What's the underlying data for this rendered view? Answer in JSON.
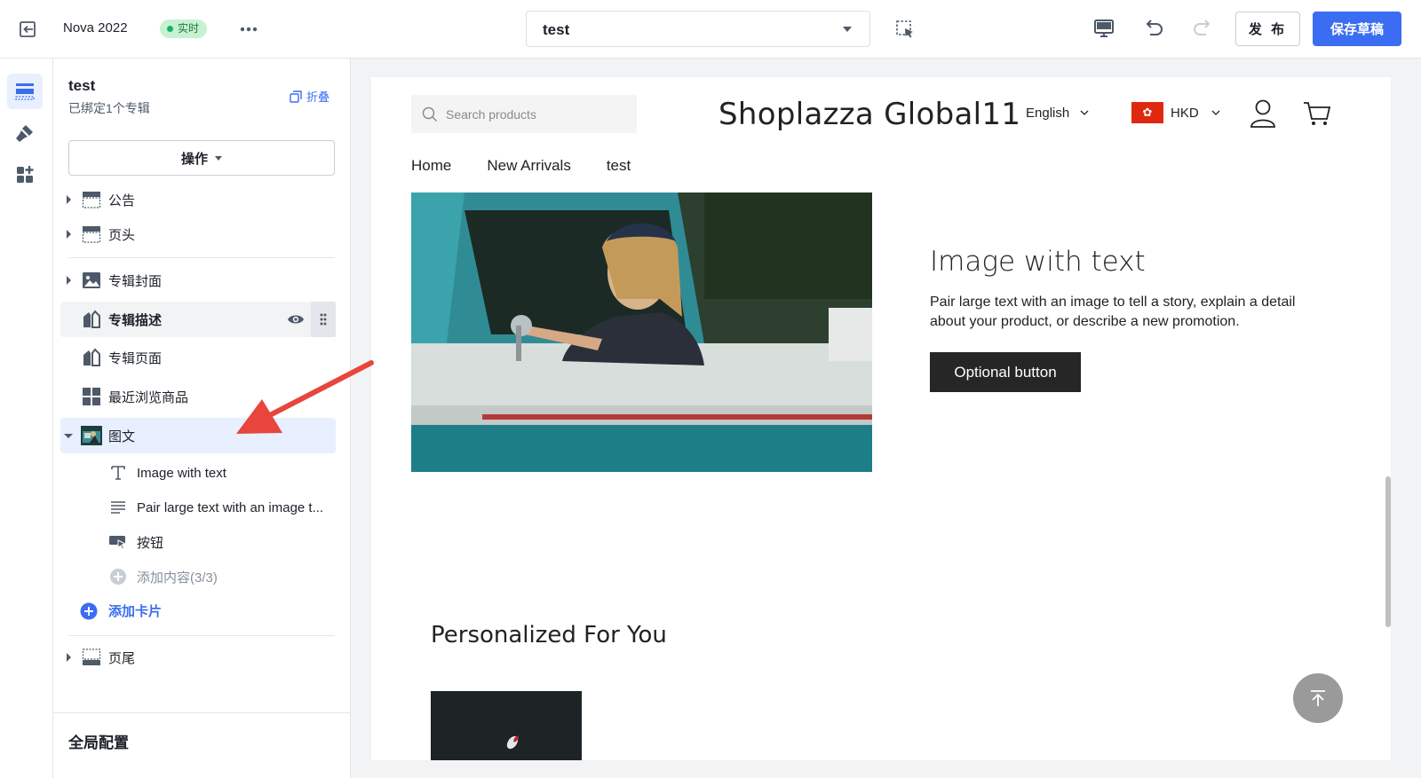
{
  "topbar": {
    "theme_name": "Nova 2022",
    "live_badge": "实时",
    "page_selector_value": "test",
    "publish_label": "发 布",
    "save_draft_label": "保存草稿"
  },
  "panel": {
    "title": "test",
    "subtitle": "已绑定1个专辑",
    "collapse_label": "折叠",
    "operations_label": "操作",
    "sections": [
      {
        "label": "公告"
      },
      {
        "label": "页头"
      },
      {
        "label": "专辑封面"
      },
      {
        "label": "专辑描述"
      },
      {
        "label": "专辑页面"
      },
      {
        "label": "最近浏览商品"
      },
      {
        "label": "图文"
      },
      {
        "label": "页尾"
      }
    ],
    "image_text_blocks": [
      {
        "label": "Image with text"
      },
      {
        "label": "Pair large text with an image t..."
      },
      {
        "label": "按钮"
      }
    ],
    "add_content_label": "添加内容(3/3)",
    "add_card_label": "添加卡片",
    "global_config_label": "全局配置"
  },
  "preview": {
    "search_placeholder": "Search products",
    "brand": "Shoplazza Global11",
    "language": "English",
    "currency": "HKD",
    "nav": [
      "Home",
      "New Arrivals",
      "test"
    ],
    "image_with_text": {
      "title": "Image with text",
      "text": "Pair large text with an image to tell a story, explain a detail about your product, or describe a new promotion.",
      "button": "Optional button"
    },
    "personalized_title": "Personalized For You"
  },
  "colors": {
    "primary": "#3b6df2",
    "live_badge_bg": "#c8f0d2",
    "live_dot": "#17b26a",
    "annotation_arrow": "#e8453c"
  }
}
